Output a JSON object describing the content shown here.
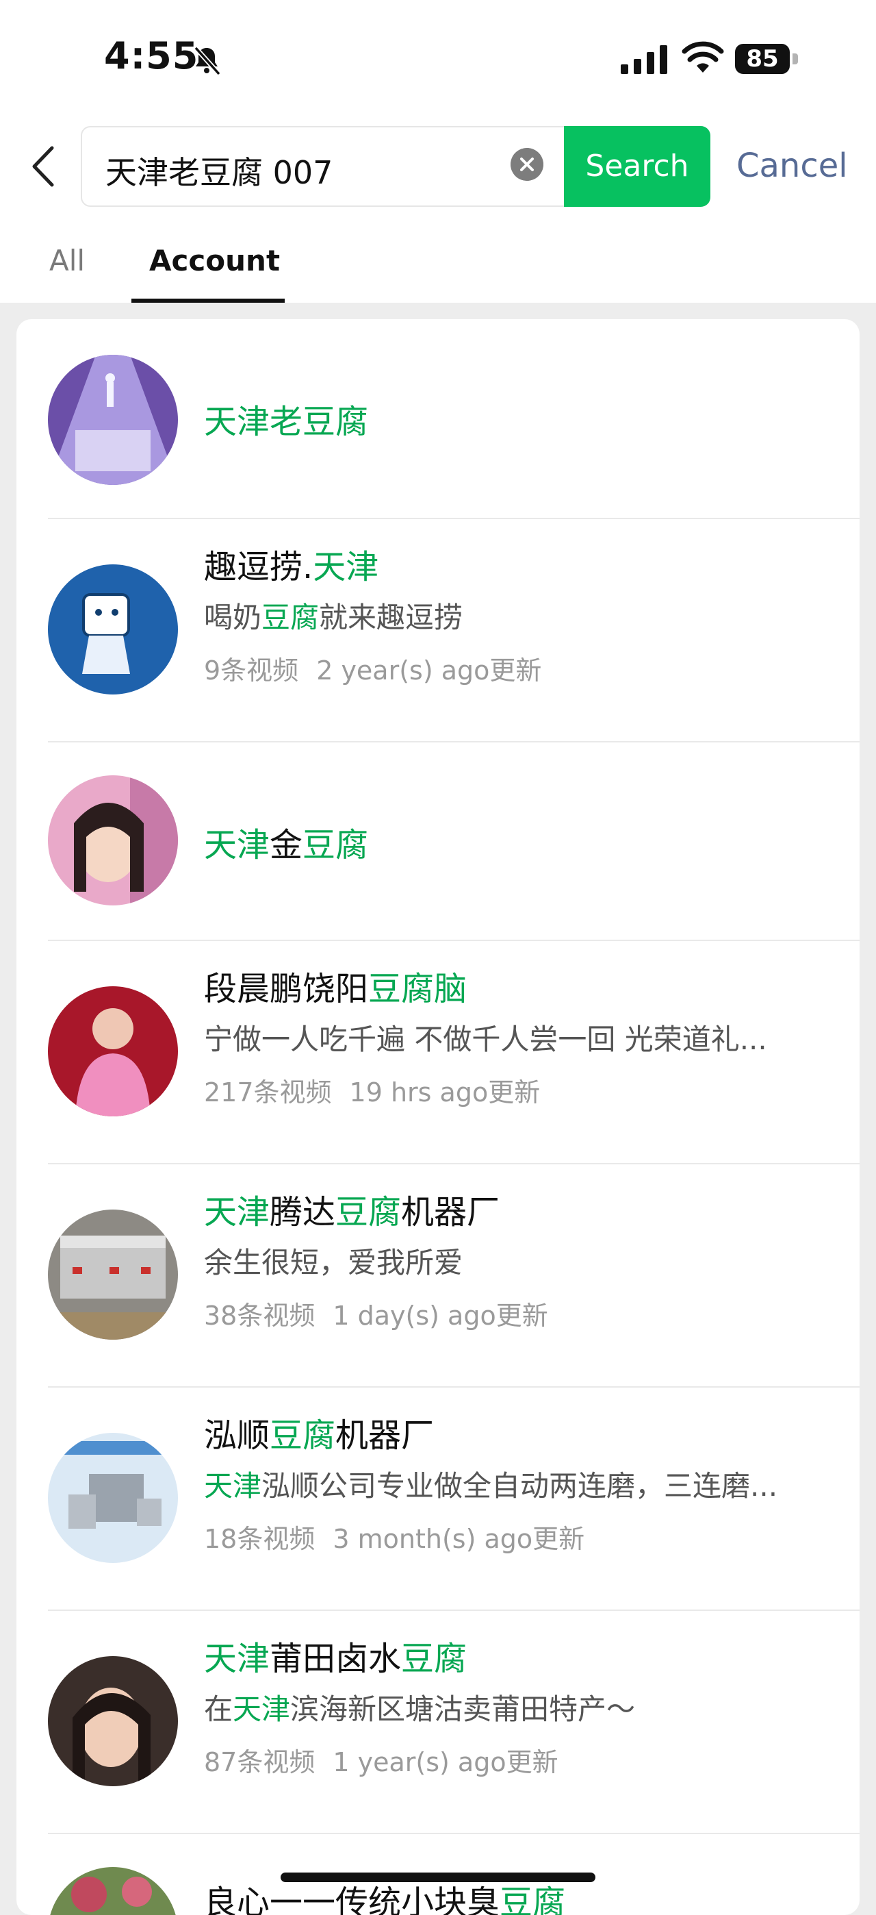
{
  "status_bar": {
    "time": "4:55",
    "battery": "85"
  },
  "search": {
    "query": "天津老豆腐 007",
    "button": "Search",
    "cancel": "Cancel"
  },
  "tabs": [
    {
      "label": "All"
    },
    {
      "label": "Account",
      "selected": true
    }
  ],
  "accounts": [
    {
      "name": [
        {
          "t": "天津老豆腐",
          "h": true
        }
      ]
    },
    {
      "name": [
        {
          "t": "趣逗捞.",
          "h": false
        },
        {
          "t": "天津",
          "h": true
        }
      ],
      "desc": [
        {
          "t": "喝奶",
          "h": false
        },
        {
          "t": "豆腐",
          "h": true
        },
        {
          "t": "就来趣逗捞",
          "h": false
        }
      ],
      "videos": "9条视频",
      "updated": "2 year(s) ago更新"
    },
    {
      "name": [
        {
          "t": "天津",
          "h": true
        },
        {
          "t": "金",
          "h": false
        },
        {
          "t": "豆腐",
          "h": true
        }
      ]
    },
    {
      "name": [
        {
          "t": "段晨鹏饶阳",
          "h": false
        },
        {
          "t": "豆腐脑",
          "h": true
        }
      ],
      "desc": [
        {
          "t": "宁做一人吃千遍 不做千人尝一回 光荣道礼...",
          "h": false
        }
      ],
      "videos": "217条视频",
      "updated": "19 hrs ago更新"
    },
    {
      "name": [
        {
          "t": "天津",
          "h": true
        },
        {
          "t": "腾达",
          "h": false
        },
        {
          "t": "豆腐",
          "h": true
        },
        {
          "t": "机器厂",
          "h": false
        }
      ],
      "desc": [
        {
          "t": "余生很短，爱我所爱",
          "h": false
        }
      ],
      "videos": "38条视频",
      "updated": "1 day(s) ago更新"
    },
    {
      "name": [
        {
          "t": "泓顺",
          "h": false
        },
        {
          "t": "豆腐",
          "h": true
        },
        {
          "t": "机器厂",
          "h": false
        }
      ],
      "desc": [
        {
          "t": "天津",
          "h": true
        },
        {
          "t": "泓顺公司专业做全自动两连磨，三连磨...",
          "h": false
        }
      ],
      "videos": "18条视频",
      "updated": "3 month(s) ago更新"
    },
    {
      "name": [
        {
          "t": "天津",
          "h": true
        },
        {
          "t": "莆田卤水",
          "h": false
        },
        {
          "t": "豆腐",
          "h": true
        }
      ],
      "desc": [
        {
          "t": "在",
          "h": false
        },
        {
          "t": "天津",
          "h": true
        },
        {
          "t": "滨海新区塘沽卖莆田特产～",
          "h": false
        }
      ],
      "videos": "87条视频",
      "updated": "1 year(s) ago更新"
    },
    {
      "name": [
        {
          "t": "良心一一传统小块臭",
          "h": false
        },
        {
          "t": "豆腐",
          "h": true
        }
      ]
    }
  ],
  "colors": {
    "accent": "#07c160",
    "highlight": "#07a752",
    "link": "#576b95"
  },
  "icons": [
    "bell-muted-icon",
    "signal-icon",
    "wifi-icon",
    "battery-icon",
    "back-chevron-icon",
    "clear-icon"
  ]
}
